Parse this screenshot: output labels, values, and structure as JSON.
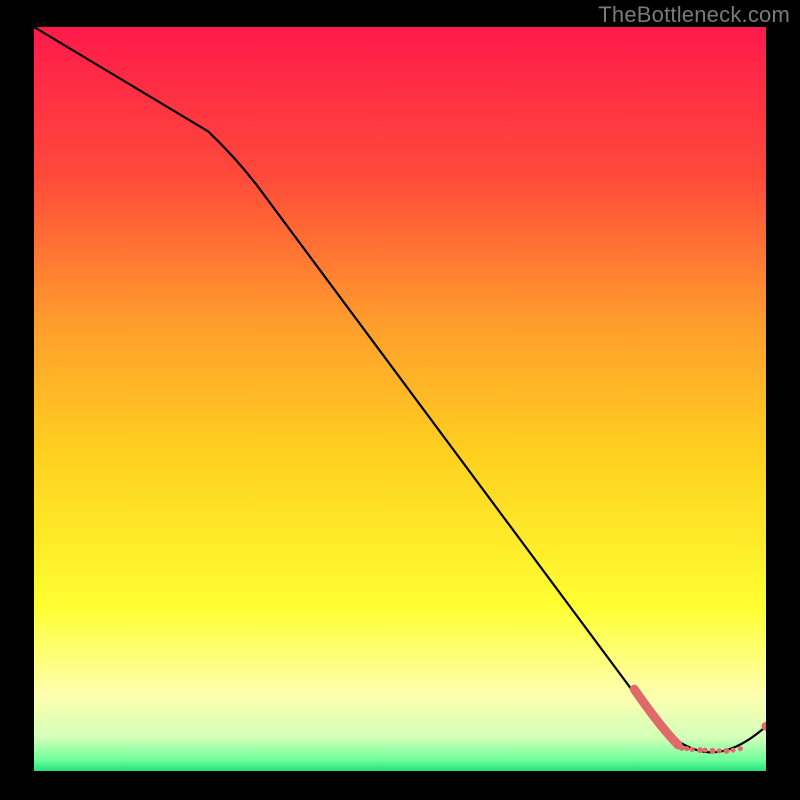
{
  "watermark": "TheBottleneck.com",
  "chart_data": {
    "type": "line",
    "title": "",
    "xlabel": "",
    "ylabel": "",
    "xlim": [
      0,
      100
    ],
    "ylim": [
      0,
      100
    ],
    "gradient_stops": [
      {
        "offset": 0,
        "color": "#ff1a4b"
      },
      {
        "offset": 0.2,
        "color": "#ff4a3a"
      },
      {
        "offset": 0.4,
        "color": "#ff9e2c"
      },
      {
        "offset": 0.58,
        "color": "#ffd21f"
      },
      {
        "offset": 0.78,
        "color": "#ffff33"
      },
      {
        "offset": 0.9,
        "color": "#fdffb0"
      },
      {
        "offset": 0.955,
        "color": "#d3ffb8"
      },
      {
        "offset": 0.985,
        "color": "#6fff9c"
      },
      {
        "offset": 1.0,
        "color": "#22e07a"
      }
    ],
    "series": [
      {
        "name": "main-curve",
        "color": "#000000",
        "points": [
          {
            "x": 0,
            "y": 100
          },
          {
            "x": 28,
            "y": 82
          },
          {
            "x": 85,
            "y": 6.5
          },
          {
            "x": 89,
            "y": 2.5
          },
          {
            "x": 96,
            "y": 2.5
          },
          {
            "x": 100,
            "y": 6
          }
        ]
      }
    ],
    "markers": {
      "name": "bottom-dots",
      "color": "#e06a6a",
      "stroke_points": [
        {
          "x": 82,
          "y": 11
        },
        {
          "x": 85.5,
          "y": 6
        },
        {
          "x": 88,
          "y": 3.5
        }
      ],
      "dots": [
        {
          "x": 88.5,
          "y": 3.1,
          "r": 3.0
        },
        {
          "x": 89.2,
          "y": 3.0,
          "r": 2.5
        },
        {
          "x": 89.9,
          "y": 2.9,
          "r": 2.5
        },
        {
          "x": 91.0,
          "y": 2.8,
          "r": 3.0
        },
        {
          "x": 91.7,
          "y": 2.8,
          "r": 2.5
        },
        {
          "x": 92.7,
          "y": 2.7,
          "r": 3.0
        },
        {
          "x": 93.6,
          "y": 2.7,
          "r": 2.5
        },
        {
          "x": 94.6,
          "y": 2.7,
          "r": 3.0
        },
        {
          "x": 95.5,
          "y": 2.8,
          "r": 2.5
        },
        {
          "x": 96.5,
          "y": 3.0,
          "r": 2.5
        },
        {
          "x": 100,
          "y": 6.0,
          "r": 4.5
        }
      ]
    }
  }
}
